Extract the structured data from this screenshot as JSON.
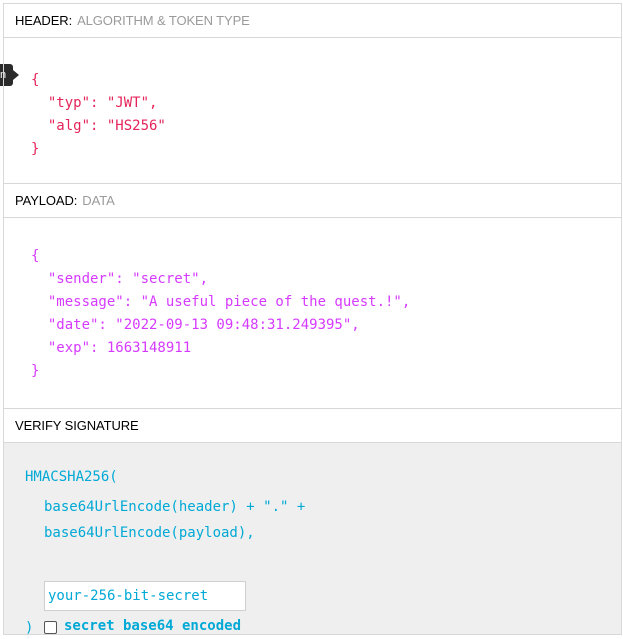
{
  "header": {
    "title": "HEADER:",
    "subtitle": "ALGORITHM & TOKEN TYPE",
    "lines": [
      "{",
      "  \"typ\": \"JWT\",",
      "  \"alg\": \"HS256\"",
      "}"
    ]
  },
  "payload": {
    "title": "PAYLOAD:",
    "subtitle": "DATA",
    "lines": [
      "{",
      "  \"sender\": \"secret\",",
      "  \"message\": \"A useful piece of the quest.!\",",
      "  \"date\": \"2022-09-13 09:48:31.249395\",",
      "  \"exp\": 1663148911",
      "}"
    ]
  },
  "verify": {
    "title": "VERIFY SIGNATURE",
    "fn": "HMACSHA256(",
    "line1": "base64UrlEncode(header) + \".\" +",
    "line2": "base64UrlEncode(payload),",
    "secret_value": "your-256-bit-secret",
    "close": ")",
    "checkbox_label": "secret base64 encoded"
  },
  "side_tab": {
    "label": "n"
  },
  "colors": {
    "header_json": "#e4245a",
    "payload_json": "#d63aff",
    "signature": "#00a9d6"
  }
}
